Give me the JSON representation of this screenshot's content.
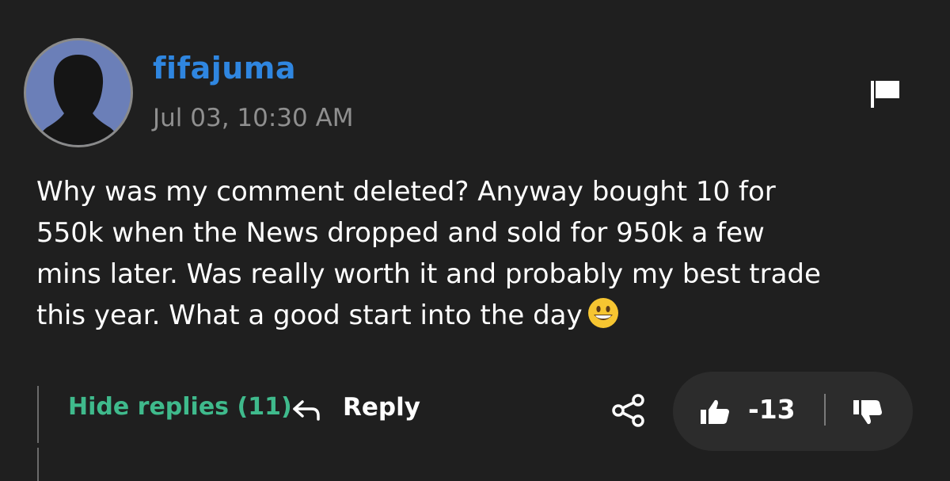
{
  "post": {
    "username": "fifajuma",
    "timestamp": "Jul 03, 10:30 AM",
    "comment": "Why was my comment deleted? Anyway bought 10 for\n550k when the News dropped and sold for 950k a few\nmins later. Was really worth it and probably my best trade\nthis year. What a good start into the day",
    "emoji": "grinning-face-icon"
  },
  "actions": {
    "hide_replies_label": "Hide replies (11)",
    "reply_label": "Reply",
    "vote_count": "-13"
  },
  "colors": {
    "background": "#1f1f1f",
    "username": "#2f86e0",
    "hide_replies": "#3fba8c",
    "timestamp": "#8f8f8f",
    "vote_pill": "#2c2c2c"
  },
  "icons": [
    "flag-icon",
    "reply-arrow-icon",
    "share-icon",
    "thumbs-up-icon",
    "thumbs-down-icon",
    "avatar-silhouette-icon"
  ]
}
